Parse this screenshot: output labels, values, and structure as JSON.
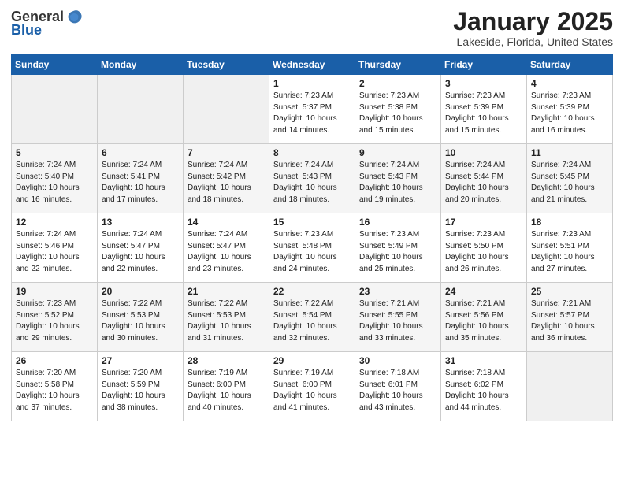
{
  "header": {
    "logo_general": "General",
    "logo_blue": "Blue",
    "month_title": "January 2025",
    "location": "Lakeside, Florida, United States"
  },
  "days_of_week": [
    "Sunday",
    "Monday",
    "Tuesday",
    "Wednesday",
    "Thursday",
    "Friday",
    "Saturday"
  ],
  "weeks": [
    [
      {
        "day": "",
        "sunrise": "",
        "sunset": "",
        "daylight": "",
        "empty": true
      },
      {
        "day": "",
        "sunrise": "",
        "sunset": "",
        "daylight": "",
        "empty": true
      },
      {
        "day": "",
        "sunrise": "",
        "sunset": "",
        "daylight": "",
        "empty": true
      },
      {
        "day": "1",
        "sunrise": "Sunrise: 7:23 AM",
        "sunset": "Sunset: 5:37 PM",
        "daylight": "Daylight: 10 hours and 14 minutes."
      },
      {
        "day": "2",
        "sunrise": "Sunrise: 7:23 AM",
        "sunset": "Sunset: 5:38 PM",
        "daylight": "Daylight: 10 hours and 15 minutes."
      },
      {
        "day": "3",
        "sunrise": "Sunrise: 7:23 AM",
        "sunset": "Sunset: 5:39 PM",
        "daylight": "Daylight: 10 hours and 15 minutes."
      },
      {
        "day": "4",
        "sunrise": "Sunrise: 7:23 AM",
        "sunset": "Sunset: 5:39 PM",
        "daylight": "Daylight: 10 hours and 16 minutes."
      }
    ],
    [
      {
        "day": "5",
        "sunrise": "Sunrise: 7:24 AM",
        "sunset": "Sunset: 5:40 PM",
        "daylight": "Daylight: 10 hours and 16 minutes."
      },
      {
        "day": "6",
        "sunrise": "Sunrise: 7:24 AM",
        "sunset": "Sunset: 5:41 PM",
        "daylight": "Daylight: 10 hours and 17 minutes."
      },
      {
        "day": "7",
        "sunrise": "Sunrise: 7:24 AM",
        "sunset": "Sunset: 5:42 PM",
        "daylight": "Daylight: 10 hours and 18 minutes."
      },
      {
        "day": "8",
        "sunrise": "Sunrise: 7:24 AM",
        "sunset": "Sunset: 5:43 PM",
        "daylight": "Daylight: 10 hours and 18 minutes."
      },
      {
        "day": "9",
        "sunrise": "Sunrise: 7:24 AM",
        "sunset": "Sunset: 5:43 PM",
        "daylight": "Daylight: 10 hours and 19 minutes."
      },
      {
        "day": "10",
        "sunrise": "Sunrise: 7:24 AM",
        "sunset": "Sunset: 5:44 PM",
        "daylight": "Daylight: 10 hours and 20 minutes."
      },
      {
        "day": "11",
        "sunrise": "Sunrise: 7:24 AM",
        "sunset": "Sunset: 5:45 PM",
        "daylight": "Daylight: 10 hours and 21 minutes."
      }
    ],
    [
      {
        "day": "12",
        "sunrise": "Sunrise: 7:24 AM",
        "sunset": "Sunset: 5:46 PM",
        "daylight": "Daylight: 10 hours and 22 minutes."
      },
      {
        "day": "13",
        "sunrise": "Sunrise: 7:24 AM",
        "sunset": "Sunset: 5:47 PM",
        "daylight": "Daylight: 10 hours and 22 minutes."
      },
      {
        "day": "14",
        "sunrise": "Sunrise: 7:24 AM",
        "sunset": "Sunset: 5:47 PM",
        "daylight": "Daylight: 10 hours and 23 minutes."
      },
      {
        "day": "15",
        "sunrise": "Sunrise: 7:23 AM",
        "sunset": "Sunset: 5:48 PM",
        "daylight": "Daylight: 10 hours and 24 minutes."
      },
      {
        "day": "16",
        "sunrise": "Sunrise: 7:23 AM",
        "sunset": "Sunset: 5:49 PM",
        "daylight": "Daylight: 10 hours and 25 minutes."
      },
      {
        "day": "17",
        "sunrise": "Sunrise: 7:23 AM",
        "sunset": "Sunset: 5:50 PM",
        "daylight": "Daylight: 10 hours and 26 minutes."
      },
      {
        "day": "18",
        "sunrise": "Sunrise: 7:23 AM",
        "sunset": "Sunset: 5:51 PM",
        "daylight": "Daylight: 10 hours and 27 minutes."
      }
    ],
    [
      {
        "day": "19",
        "sunrise": "Sunrise: 7:23 AM",
        "sunset": "Sunset: 5:52 PM",
        "daylight": "Daylight: 10 hours and 29 minutes."
      },
      {
        "day": "20",
        "sunrise": "Sunrise: 7:22 AM",
        "sunset": "Sunset: 5:53 PM",
        "daylight": "Daylight: 10 hours and 30 minutes."
      },
      {
        "day": "21",
        "sunrise": "Sunrise: 7:22 AM",
        "sunset": "Sunset: 5:53 PM",
        "daylight": "Daylight: 10 hours and 31 minutes."
      },
      {
        "day": "22",
        "sunrise": "Sunrise: 7:22 AM",
        "sunset": "Sunset: 5:54 PM",
        "daylight": "Daylight: 10 hours and 32 minutes."
      },
      {
        "day": "23",
        "sunrise": "Sunrise: 7:21 AM",
        "sunset": "Sunset: 5:55 PM",
        "daylight": "Daylight: 10 hours and 33 minutes."
      },
      {
        "day": "24",
        "sunrise": "Sunrise: 7:21 AM",
        "sunset": "Sunset: 5:56 PM",
        "daylight": "Daylight: 10 hours and 35 minutes."
      },
      {
        "day": "25",
        "sunrise": "Sunrise: 7:21 AM",
        "sunset": "Sunset: 5:57 PM",
        "daylight": "Daylight: 10 hours and 36 minutes."
      }
    ],
    [
      {
        "day": "26",
        "sunrise": "Sunrise: 7:20 AM",
        "sunset": "Sunset: 5:58 PM",
        "daylight": "Daylight: 10 hours and 37 minutes."
      },
      {
        "day": "27",
        "sunrise": "Sunrise: 7:20 AM",
        "sunset": "Sunset: 5:59 PM",
        "daylight": "Daylight: 10 hours and 38 minutes."
      },
      {
        "day": "28",
        "sunrise": "Sunrise: 7:19 AM",
        "sunset": "Sunset: 6:00 PM",
        "daylight": "Daylight: 10 hours and 40 minutes."
      },
      {
        "day": "29",
        "sunrise": "Sunrise: 7:19 AM",
        "sunset": "Sunset: 6:00 PM",
        "daylight": "Daylight: 10 hours and 41 minutes."
      },
      {
        "day": "30",
        "sunrise": "Sunrise: 7:18 AM",
        "sunset": "Sunset: 6:01 PM",
        "daylight": "Daylight: 10 hours and 43 minutes."
      },
      {
        "day": "31",
        "sunrise": "Sunrise: 7:18 AM",
        "sunset": "Sunset: 6:02 PM",
        "daylight": "Daylight: 10 hours and 44 minutes."
      },
      {
        "day": "",
        "sunrise": "",
        "sunset": "",
        "daylight": "",
        "empty": true
      }
    ]
  ]
}
